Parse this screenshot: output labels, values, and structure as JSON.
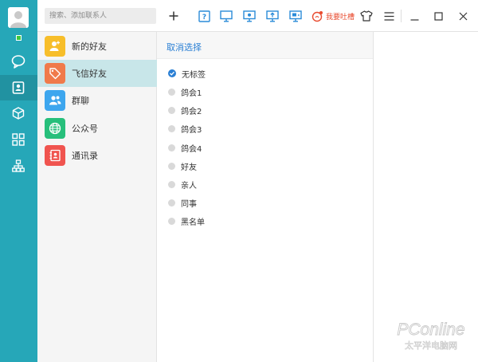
{
  "search": {
    "placeholder": "搜索、添加联系人"
  },
  "toolbar": {
    "add_icon": "plus-icon",
    "icons": [
      "help-screen-icon",
      "screen-icon",
      "screen-share-icon",
      "screen-upload-icon",
      "screen-cast-icon"
    ],
    "feedback_label": "我要吐槽",
    "accent": "#2a8bd8",
    "feedback_color": "#e84b2f"
  },
  "nav": {
    "bg": "#26a7b8",
    "icons": [
      "chat-icon",
      "contacts-icon",
      "cube-icon",
      "apps-icon",
      "org-chart-icon"
    ]
  },
  "contact_list": [
    {
      "label": "新的好友",
      "icon": "new-friend-icon",
      "color": "#f7be2a"
    },
    {
      "label": "飞信好友",
      "icon": "tag-icon",
      "color": "#f07a4a"
    },
    {
      "label": "群聊",
      "icon": "group-icon",
      "color": "#3da6ee"
    },
    {
      "label": "公众号",
      "icon": "globe-icon",
      "color": "#27bf7b"
    },
    {
      "label": "通讯录",
      "icon": "address-book-icon",
      "color": "#f0544f"
    }
  ],
  "tags_panel": {
    "cancel_label": "取消选择",
    "tags": [
      {
        "label": "无标签",
        "checked": true
      },
      {
        "label": "鸽会1",
        "checked": false
      },
      {
        "label": "鸽会2",
        "checked": false
      },
      {
        "label": "鸽会3",
        "checked": false
      },
      {
        "label": "鸽会4",
        "checked": false
      },
      {
        "label": "好友",
        "checked": false
      },
      {
        "label": "亲人",
        "checked": false
      },
      {
        "label": "同事",
        "checked": false
      },
      {
        "label": "黑名单",
        "checked": false
      }
    ]
  },
  "watermark": {
    "text": "PConline",
    "subtext": "太平洋电脑网"
  }
}
